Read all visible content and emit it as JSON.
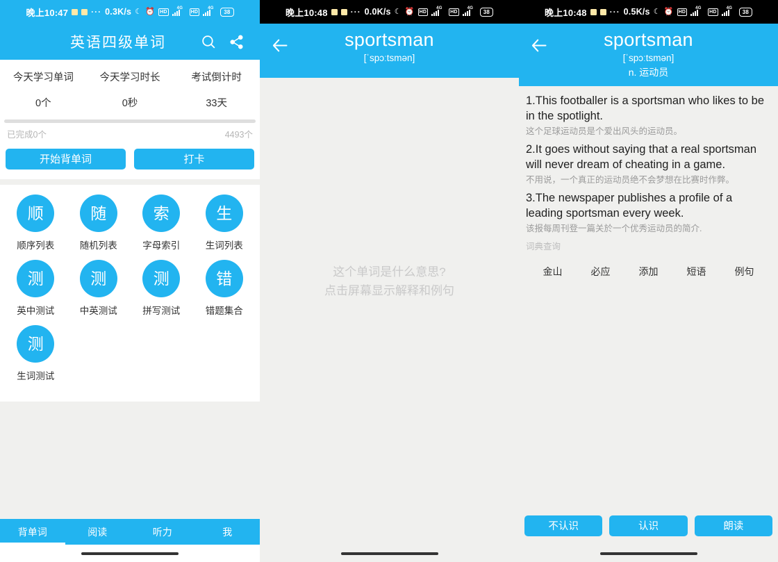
{
  "panels": [
    {
      "status": {
        "time": "晚上10:47",
        "dots": "···",
        "net": "0.3K/s",
        "moon_icon": "moon-icon",
        "alarm_icon": "alarm-icon",
        "hd": "HD",
        "gen": "4G",
        "battery": "38"
      },
      "header": {
        "title": "英语四级单词",
        "search_icon": "search-icon",
        "share_icon": "share-icon"
      },
      "stats": [
        {
          "label": "今天学习单词",
          "value": "0个"
        },
        {
          "label": "今天学习时长",
          "value": "0秒"
        },
        {
          "label": "考试倒计时",
          "value": "33天"
        }
      ],
      "progress": {
        "percent": 0,
        "done_text": "已完成0个",
        "total_text": "4493个"
      },
      "actions": [
        {
          "label": "开始背单词"
        },
        {
          "label": "打卡"
        }
      ],
      "grid": [
        {
          "glyph": "顺",
          "label": "顺序列表"
        },
        {
          "glyph": "随",
          "label": "随机列表"
        },
        {
          "glyph": "索",
          "label": "字母索引"
        },
        {
          "glyph": "生",
          "label": "生词列表"
        },
        {
          "glyph": "测",
          "label": "英中测试"
        },
        {
          "glyph": "测",
          "label": "中英测试"
        },
        {
          "glyph": "测",
          "label": "拼写测试"
        },
        {
          "glyph": "错",
          "label": "错题集合"
        },
        {
          "glyph": "测",
          "label": "生词测试"
        }
      ],
      "tabs": [
        {
          "label": "背单词",
          "active": true
        },
        {
          "label": "阅读",
          "active": false
        },
        {
          "label": "听力",
          "active": false
        },
        {
          "label": "我",
          "active": false
        }
      ]
    },
    {
      "status": {
        "time": "晚上10:48",
        "dots": "···",
        "net": "0.0K/s",
        "moon_icon": "moon-icon",
        "alarm_icon": "alarm-icon",
        "hd": "HD",
        "gen": "4G",
        "battery": "38"
      },
      "header": {
        "back_icon": "back-arrow-icon",
        "word": "sportsman",
        "phonetic": "[ˈspɔːtsmən]"
      },
      "hint_line1": "这个单词是什么意思?",
      "hint_line2": "点击屏幕显示解释和例句"
    },
    {
      "status": {
        "time": "晚上10:48",
        "dots": "···",
        "net": "0.5K/s",
        "moon_icon": "moon-icon",
        "alarm_icon": "alarm-icon",
        "hd": "HD",
        "gen": "4G",
        "battery": "38"
      },
      "header": {
        "back_icon": "back-arrow-icon",
        "word": "sportsman",
        "phonetic": "[ˈspɔːtsmən]",
        "meaning": "n. 运动员"
      },
      "sentences": [
        {
          "en": "1.This footballer is a sportsman who likes to be in the spotlight.",
          "cn": "这个足球运动员是个爱出风头的运动员。"
        },
        {
          "en": "2.It goes without saying that a real sportsman will never dream of cheating in a game.",
          "cn": "不用说，一个真正的运动员绝不会梦想在比赛时作弊。"
        },
        {
          "en": "3.The newspaper publishes a profile of a leading sportsman every week.",
          "cn": "该报每周刊登一篇关於一个优秀运动员的简介."
        }
      ],
      "dict_label": "词典查询",
      "dict_items": [
        {
          "label": "金山"
        },
        {
          "label": "必应"
        },
        {
          "label": "添加"
        },
        {
          "label": "短语"
        },
        {
          "label": "例句"
        }
      ],
      "bottom_buttons": [
        {
          "label": "不认识"
        },
        {
          "label": "认识"
        },
        {
          "label": "朗读"
        }
      ]
    }
  ],
  "theme": {
    "accent": "#22b4f0",
    "page_bg": "#f0f0ee",
    "card_bg": "#ffffff",
    "text_dark": "#333333",
    "text_muted": "#9b9b9b"
  }
}
